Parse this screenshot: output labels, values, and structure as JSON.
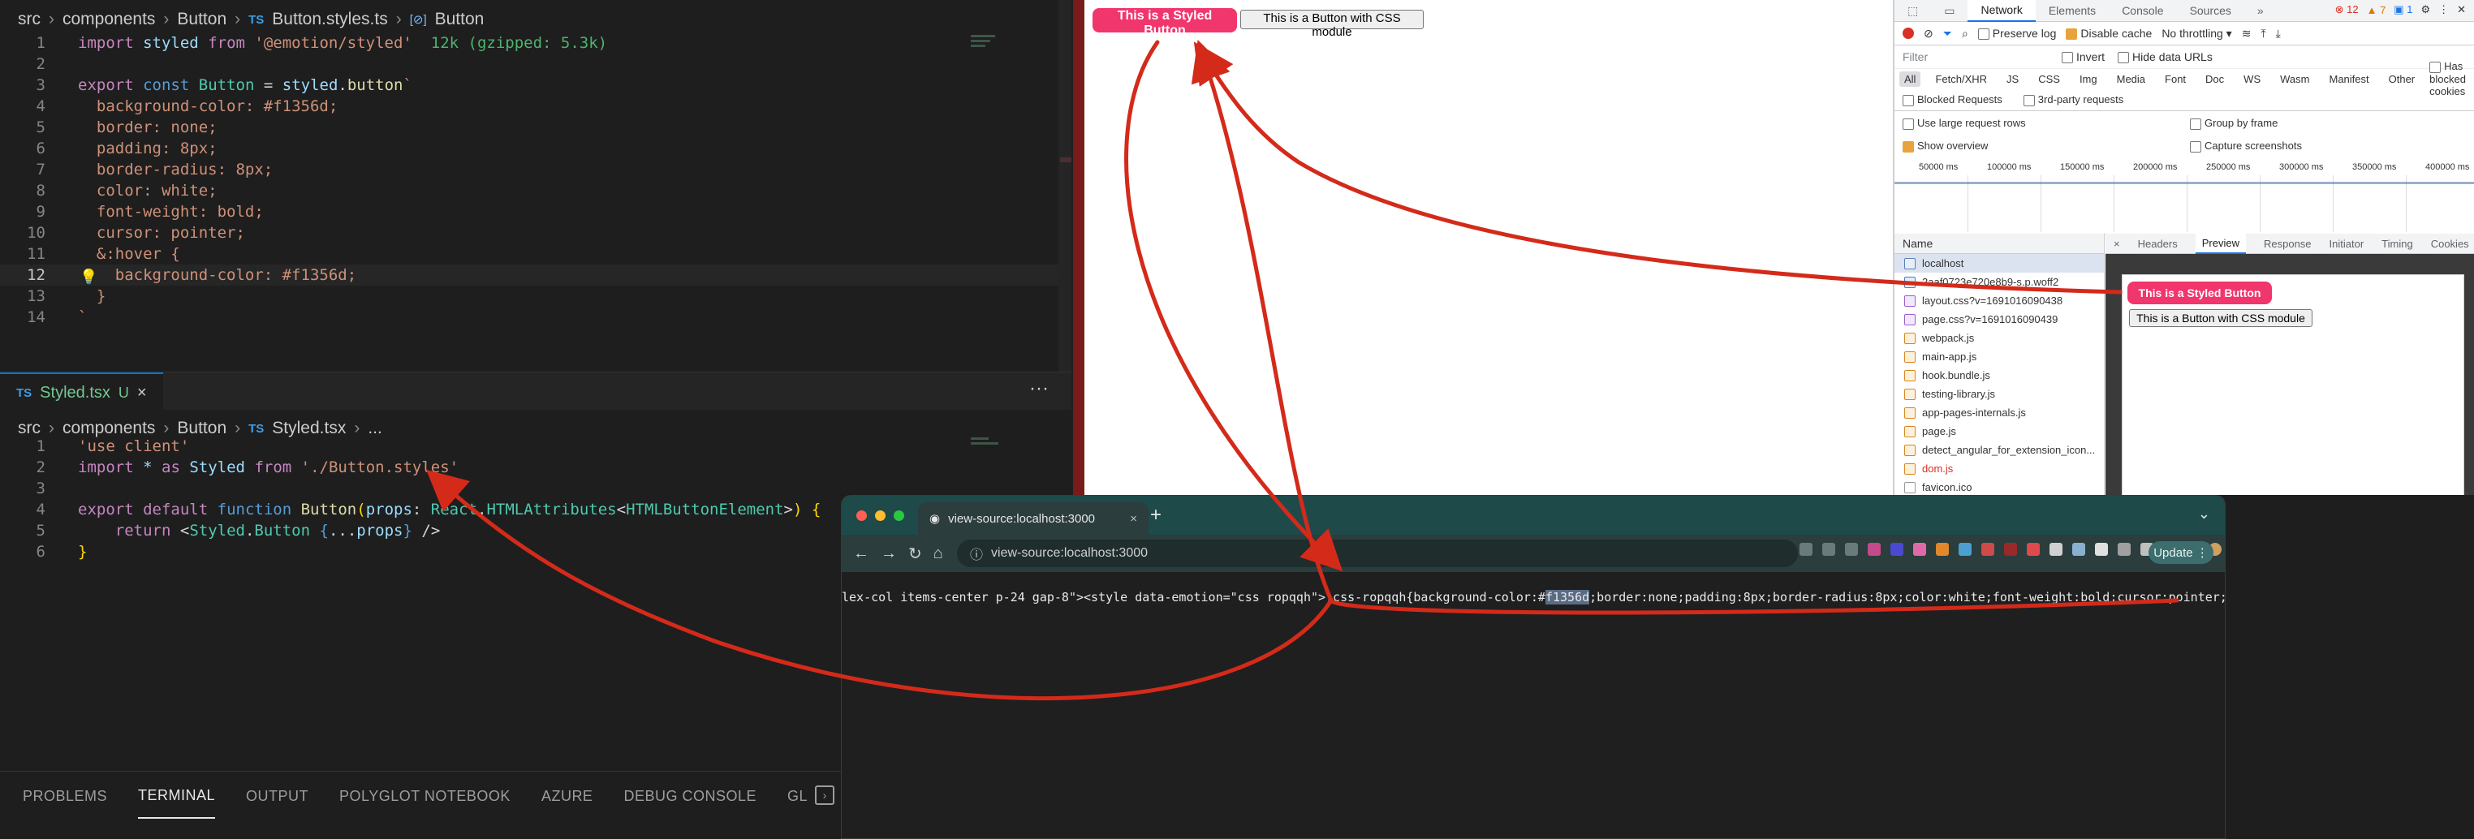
{
  "vscode": {
    "top_breadcrumb": [
      "src",
      "components",
      "Button",
      "Button.styles.ts",
      "Button"
    ],
    "top_code": [
      {
        "n": "1",
        "html": "<span class='t-ctl'>import</span> <span class='t-var'>styled</span> <span class='t-ctl'>from</span> <span class='t-str'>'@emotion/styled'</span>  <span class='t-hint'>12k (gzipped: 5.3k)</span>"
      },
      {
        "n": "2",
        "html": ""
      },
      {
        "n": "3",
        "html": "<span class='t-ctl'>export</span> <span class='t-kw'>const</span> <span class='t-type'>Button</span> <span class='t-plain'>=</span> <span class='t-var'>styled</span><span class='t-plain'>.</span><span class='t-fn'>button</span><span class='t-css'>`</span>"
      },
      {
        "n": "4",
        "html": "<span class='t-css'>  background-color: #f1356d;</span>"
      },
      {
        "n": "5",
        "html": "<span class='t-css'>  border: none;</span>"
      },
      {
        "n": "6",
        "html": "<span class='t-css'>  padding: 8px;</span>"
      },
      {
        "n": "7",
        "html": "<span class='t-css'>  border-radius: 8px;</span>"
      },
      {
        "n": "8",
        "html": "<span class='t-css'>  color: white;</span>"
      },
      {
        "n": "9",
        "html": "<span class='t-css'>  font-weight: bold;</span>"
      },
      {
        "n": "10",
        "html": "<span class='t-css'>  cursor: pointer;</span>"
      },
      {
        "n": "11",
        "html": "<span class='t-css'>  &amp;:hover {</span>"
      },
      {
        "n": "12",
        "html": "<span class='t-css'>    background-color: #f1356d;</span>",
        "current": true
      },
      {
        "n": "13",
        "html": "<span class='t-css'>  }</span>"
      },
      {
        "n": "14",
        "html": "<span class='t-css'>`</span>"
      }
    ],
    "tab": {
      "name": "Styled.tsx",
      "badge": "TS",
      "modified": "U",
      "close": "×"
    },
    "tab_more": "···",
    "bottom_breadcrumb": [
      "src",
      "components",
      "Button",
      "Styled.tsx",
      "..."
    ],
    "bottom_code": [
      {
        "n": "1",
        "html": "<span class='t-str'>'use client'</span>"
      },
      {
        "n": "2",
        "html": "<span class='t-ctl'>import</span> <span class='t-var'>*</span> <span class='t-ctl'>as</span> <span class='t-var'>Styled</span> <span class='t-ctl'>from</span> <span class='t-str'>'./Button.styles'</span>"
      },
      {
        "n": "3",
        "html": ""
      },
      {
        "n": "4",
        "html": "<span class='t-ctl'>export</span> <span class='t-ctl'>default</span> <span class='t-kw'>function</span> <span class='t-fn'>Button</span><span class='t-yellow'>(</span><span class='t-var'>props</span><span class='t-plain'>:</span> <span class='t-type'>React</span><span class='t-plain'>.</span><span class='t-type'>HTMLAttributes</span><span class='t-plain'>&lt;</span><span class='t-type'>HTMLButtonElement</span><span class='t-plain'>&gt;</span><span class='t-yellow'>)</span> <span class='t-yellow'>{</span>"
      },
      {
        "n": "5",
        "html": "    <span class='t-ctl'>return</span> <span class='t-plain'>&lt;</span><span class='t-type'>Styled</span><span class='t-plain'>.</span><span class='t-type'>Button</span> <span class='t-kw'>{</span><span class='t-plain'>...</span><span class='t-var'>props</span><span class='t-kw'>}</span> <span class='t-plain'>/&gt;</span>"
      },
      {
        "n": "6",
        "html": "<span class='t-yellow'>}</span>"
      }
    ],
    "panel_tabs": [
      "PROBLEMS",
      "TERMINAL",
      "OUTPUT",
      "POLYGLOT NOTEBOOK",
      "AZURE",
      "DEBUG CONSOLE",
      "GL"
    ],
    "active_panel_tab": "TERMINAL"
  },
  "page": {
    "styled_button": "This is a Styled Button",
    "css_button": "This is a Button with CSS module"
  },
  "devtools": {
    "tabs": [
      "Elements",
      "Console",
      "Sources",
      "»"
    ],
    "active_tab": "Network",
    "errors": "12",
    "warnings": "7",
    "info": "1",
    "preserve_log": "Preserve log",
    "disable_cache": "Disable cache",
    "throttling": "No throttling",
    "filter_placeholder": "Filter",
    "invert": "Invert",
    "hide_data_urls": "Hide data URLs",
    "types": [
      "All",
      "Fetch/XHR",
      "JS",
      "CSS",
      "Img",
      "Media",
      "Font",
      "Doc",
      "WS",
      "Wasm",
      "Manifest",
      "Other"
    ],
    "has_blocked_cookies": "Has blocked cookies",
    "blocked_requests": "Blocked Requests",
    "third_party": "3rd-party requests",
    "large_rows": "Use large request rows",
    "group_by_frame": "Group by frame",
    "show_overview": "Show overview",
    "capture_screenshots": "Capture screenshots",
    "timeline_labels": [
      "50000 ms",
      "100000 ms",
      "150000 ms",
      "200000 ms",
      "250000 ms",
      "300000 ms",
      "350000 ms",
      "400000 ms"
    ],
    "name_header": "Name",
    "requests": [
      {
        "name": "localhost",
        "kind": "doc",
        "selected": true
      },
      {
        "name": "2aaf0723e720e8b9-s.p.woff2",
        "kind": "font"
      },
      {
        "name": "layout.css?v=1691016090438",
        "kind": "css"
      },
      {
        "name": "page.css?v=1691016090439",
        "kind": "css"
      },
      {
        "name": "webpack.js",
        "kind": "js"
      },
      {
        "name": "main-app.js",
        "kind": "js"
      },
      {
        "name": "hook.bundle.js",
        "kind": "js"
      },
      {
        "name": "testing-library.js",
        "kind": "js"
      },
      {
        "name": "app-pages-internals.js",
        "kind": "js"
      },
      {
        "name": "page.js",
        "kind": "js"
      },
      {
        "name": "detect_angular_for_extension_icon...",
        "kind": "js"
      },
      {
        "name": "dom.js",
        "kind": "js",
        "red": true
      },
      {
        "name": "favicon.ico",
        "kind": "other"
      }
    ],
    "detail_close": "×",
    "detail_tabs": [
      "Headers",
      "Preview",
      "Response",
      "Initiator",
      "Timing",
      "Cookies"
    ],
    "active_detail_tab": "Preview",
    "preview_styled": "This is a Styled Button",
    "preview_css": "This is a Button with CSS module"
  },
  "view_source": {
    "tab_title": "view-source:localhost:3000",
    "tab_close": "×",
    "new_tab": "+",
    "url": "view-source:localhost:3000",
    "update_label": "Update",
    "source_before": "lex-col items-center p-24 gap-8\"><style data-emotion=\"css ropqqh\">.css-ropqqh{background-color:#",
    "source_highlight": "f1356d",
    "source_after": ";border:none;padding:8px;border-radius:8px;color:white;font-weight:bold;cursor:pointer;}.css-ropq"
  },
  "colors": {
    "accent_pink": "#f1356d",
    "arrow_red": "#d42a1a",
    "vscode_bg": "#1e1e1e"
  }
}
